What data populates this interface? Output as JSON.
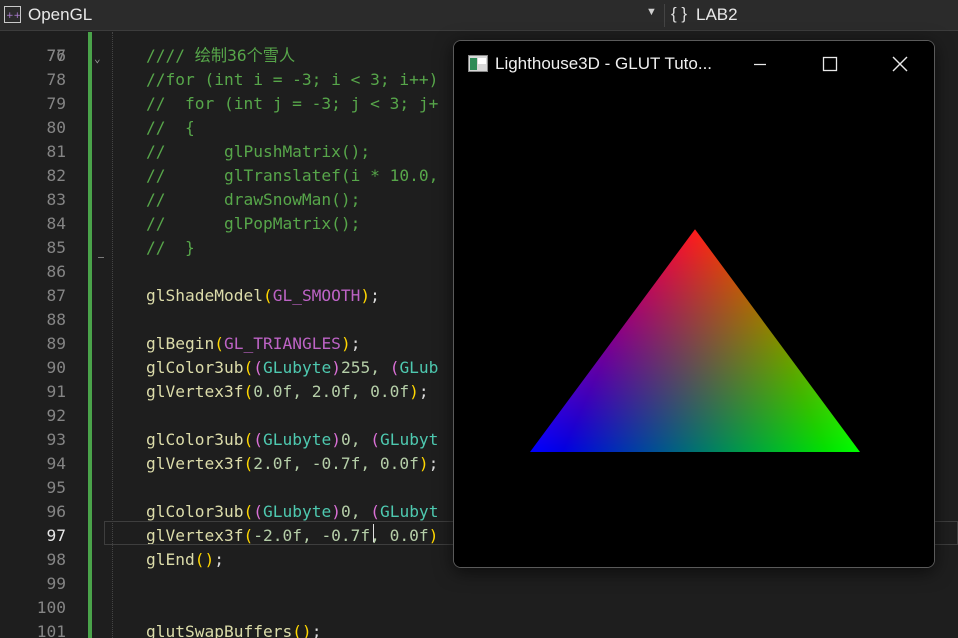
{
  "navbar": {
    "project": "OpenGL",
    "project_icon": "cpp-project-icon",
    "scope_icon": "braces-icon",
    "scope_icon_glyph": "{ }",
    "scope": "LAB2"
  },
  "editor": {
    "partial_top_line": "76",
    "active_line": "97",
    "lines": [
      {
        "n": "77",
        "segments": [
          {
            "t": "//// 绘制36个雪人",
            "c": "cmt"
          }
        ]
      },
      {
        "n": "78",
        "segments": [
          {
            "t": "//for (int i = -3; i < 3; i++)",
            "c": "cmt"
          }
        ]
      },
      {
        "n": "79",
        "segments": [
          {
            "t": "//  for (int j = -3; j < 3; j+",
            "c": "cmt"
          }
        ]
      },
      {
        "n": "80",
        "segments": [
          {
            "t": "//  {",
            "c": "cmt"
          }
        ]
      },
      {
        "n": "81",
        "segments": [
          {
            "t": "//      glPushMatrix();",
            "c": "cmt"
          }
        ]
      },
      {
        "n": "82",
        "segments": [
          {
            "t": "//      glTranslatef(i * 10.0,",
            "c": "cmt"
          }
        ]
      },
      {
        "n": "83",
        "segments": [
          {
            "t": "//      drawSnowMan();",
            "c": "cmt"
          }
        ]
      },
      {
        "n": "84",
        "segments": [
          {
            "t": "//      glPopMatrix();",
            "c": "cmt"
          }
        ]
      },
      {
        "n": "85",
        "segments": [
          {
            "t": "//  }",
            "c": "cmt"
          }
        ]
      },
      {
        "n": "86",
        "segments": []
      },
      {
        "n": "87",
        "segments": [
          {
            "t": "glShadeModel",
            "c": "fn"
          },
          {
            "t": "(",
            "c": "p1"
          },
          {
            "t": "GL_SMOOTH",
            "c": "mac"
          },
          {
            "t": ")",
            "c": "p1"
          },
          {
            "t": ";",
            "c": "op"
          }
        ]
      },
      {
        "n": "88",
        "segments": []
      },
      {
        "n": "89",
        "segments": [
          {
            "t": "glBegin",
            "c": "fn"
          },
          {
            "t": "(",
            "c": "p1"
          },
          {
            "t": "GL_TRIANGLES",
            "c": "mac"
          },
          {
            "t": ")",
            "c": "p1"
          },
          {
            "t": ";",
            "c": "op"
          }
        ]
      },
      {
        "n": "90",
        "segments": [
          {
            "t": "glColor3ub",
            "c": "fn"
          },
          {
            "t": "(",
            "c": "p1"
          },
          {
            "t": "(",
            "c": "p2"
          },
          {
            "t": "GLubyte",
            "c": "typ"
          },
          {
            "t": ")",
            "c": "p2"
          },
          {
            "t": "255, ",
            "c": "num"
          },
          {
            "t": "(",
            "c": "p2"
          },
          {
            "t": "GLub",
            "c": "typ"
          }
        ]
      },
      {
        "n": "91",
        "segments": [
          {
            "t": "glVertex3f",
            "c": "fn"
          },
          {
            "t": "(",
            "c": "p1"
          },
          {
            "t": "0.0f, 2.0f, 0.0f",
            "c": "num"
          },
          {
            "t": ")",
            "c": "p1"
          },
          {
            "t": ";",
            "c": "op"
          }
        ]
      },
      {
        "n": "92",
        "segments": []
      },
      {
        "n": "93",
        "segments": [
          {
            "t": "glColor3ub",
            "c": "fn"
          },
          {
            "t": "(",
            "c": "p1"
          },
          {
            "t": "(",
            "c": "p2"
          },
          {
            "t": "GLubyte",
            "c": "typ"
          },
          {
            "t": ")",
            "c": "p2"
          },
          {
            "t": "0, ",
            "c": "num"
          },
          {
            "t": "(",
            "c": "p2"
          },
          {
            "t": "GLubyt",
            "c": "typ"
          }
        ]
      },
      {
        "n": "94",
        "segments": [
          {
            "t": "glVertex3f",
            "c": "fn"
          },
          {
            "t": "(",
            "c": "p1"
          },
          {
            "t": "2.0f, -0.7f, 0.0f",
            "c": "num"
          },
          {
            "t": ")",
            "c": "p1"
          },
          {
            "t": ";",
            "c": "op"
          }
        ]
      },
      {
        "n": "95",
        "segments": []
      },
      {
        "n": "96",
        "segments": [
          {
            "t": "glColor3ub",
            "c": "fn"
          },
          {
            "t": "(",
            "c": "p1"
          },
          {
            "t": "(",
            "c": "p2"
          },
          {
            "t": "GLubyte",
            "c": "typ"
          },
          {
            "t": ")",
            "c": "p2"
          },
          {
            "t": "0, ",
            "c": "num"
          },
          {
            "t": "(",
            "c": "p2"
          },
          {
            "t": "GLuby",
            "c": "typ"
          },
          {
            "t": "t",
            "c": "typ"
          }
        ]
      },
      {
        "n": "97",
        "segments": [
          {
            "t": "glVertex3f",
            "c": "fn"
          },
          {
            "t": "(",
            "c": "p1"
          },
          {
            "t": "-2.0f, -0.7f, 0.0f",
            "c": "num"
          },
          {
            "t": ")",
            "c": "p1"
          }
        ]
      },
      {
        "n": "98",
        "segments": [
          {
            "t": "glEnd",
            "c": "fn"
          },
          {
            "t": "()",
            "c": "p1"
          },
          {
            "t": ";",
            "c": "op"
          }
        ]
      },
      {
        "n": "99",
        "segments": []
      },
      {
        "n": "100",
        "segments": []
      },
      {
        "n": "101",
        "segments": [
          {
            "t": "glutSwapBuffers",
            "c": "fn"
          },
          {
            "t": "()",
            "c": "p1"
          },
          {
            "t": ";",
            "c": "op"
          }
        ]
      }
    ]
  },
  "glut_window": {
    "title": "Lighthouse3D - GLUT Tuto...",
    "app_icon": "window-app-icon",
    "controls": {
      "minimize": "minimize-icon",
      "maximize": "maximize-icon",
      "close": "close-icon"
    },
    "triangle": {
      "vertices": [
        {
          "position": [
            0.0,
            2.0,
            0.0
          ],
          "color": "#ff0000"
        },
        {
          "position": [
            2.0,
            -0.7,
            0.0
          ],
          "color": "#00ff00"
        },
        {
          "position": [
            -2.0,
            -0.7,
            0.0
          ],
          "color": "#0000ff"
        }
      ]
    }
  }
}
